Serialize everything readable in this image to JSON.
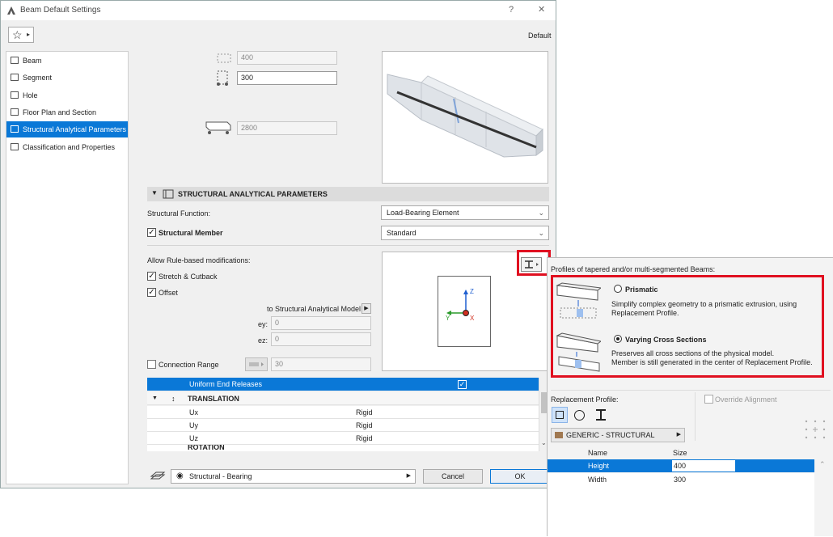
{
  "window": {
    "title": "Beam Default Settings",
    "help": "?",
    "close": "✕",
    "favorites_label": "☆",
    "default_label": "Default"
  },
  "sidebar": {
    "items": [
      {
        "label": "Beam"
      },
      {
        "label": "Segment"
      },
      {
        "label": "Hole"
      },
      {
        "label": "Floor Plan and Section"
      },
      {
        "label": "Structural Analytical Parameters"
      },
      {
        "label": "Classification and Properties"
      }
    ]
  },
  "geometry": {
    "width": "400",
    "height": "300",
    "length": "2800"
  },
  "sap": {
    "section_title": "STRUCTURAL ANALYTICAL PARAMETERS",
    "structural_function_label": "Structural Function:",
    "structural_function_value": "Load-Bearing Element",
    "structural_member_label": "Structural Member",
    "structural_member_value": "Standard",
    "allow_rule_label": "Allow Rule-based modifications:",
    "stretch_label": "Stretch & Cutback",
    "offset_label": "Offset",
    "to_model_label": "to Structural Analytical Model",
    "ey_label": "ey:",
    "ey_value": "0",
    "ez_label": "ez:",
    "ez_value": "0",
    "connection_range_label": "Connection Range",
    "connection_range_value": "30",
    "axis_z": "Z",
    "axis_y": "Y",
    "axis_x": "X"
  },
  "releases": {
    "header": "Uniform End Releases",
    "translation_label": "TRANSLATION",
    "rotation_label": "ROTATION",
    "rows": [
      {
        "name": "Ux",
        "value": "Rigid"
      },
      {
        "name": "Uy",
        "value": "Rigid"
      },
      {
        "name": "Uz",
        "value": "Rigid"
      }
    ]
  },
  "footer": {
    "layer": "Structural - Bearing",
    "cancel": "Cancel",
    "ok": "OK"
  },
  "popup": {
    "heading": "Profiles of tapered and/or multi-segmented Beams:",
    "prismatic_title": "Prismatic",
    "prismatic_desc_1": "Simplify complex geometry to a prismatic extrusion, using",
    "prismatic_desc_2": "Replacement Profile.",
    "varying_title": "Varying Cross Sections",
    "varying_desc_1": "Preserves all cross sections of the physical model.",
    "varying_desc_2": "Member is still generated in the center of Replacement Profile.",
    "replacement_label": "Replacement Profile:",
    "override_label": "Override Alignment",
    "profile_value": "GENERIC - STRUCTURAL",
    "table_headers": {
      "name": "Name",
      "size": "Size"
    },
    "table_rows": [
      {
        "name": "Height",
        "size": "400"
      },
      {
        "name": "Width",
        "size": "300"
      }
    ]
  },
  "colors": {
    "selected": "#0a78d7",
    "highlight": "#e01020"
  }
}
